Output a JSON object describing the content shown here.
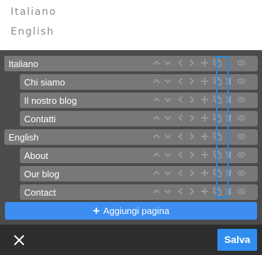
{
  "language_switcher": {
    "items": [
      "Italiano",
      "English"
    ]
  },
  "pages": {
    "italiano": {
      "label": "Italiano",
      "children": [
        "Chi siamo",
        "Il nostro blog",
        "Contatti"
      ]
    },
    "english": {
      "label": "English",
      "children": [
        "About",
        "Our blog",
        "Contact"
      ]
    }
  },
  "row_icons": [
    "chevron-up-icon",
    "chevron-down-icon",
    "chevron-left-icon",
    "chevron-right-icon",
    "plus-icon",
    "copy-icon",
    "trash-icon",
    "eye-icon"
  ],
  "add_page_label": "Aggiungi pagina",
  "footer": {
    "save_label": "Salva"
  },
  "colors": {
    "panel_bg": "#4b4b4b",
    "row_bg": "#787878",
    "accent": "#3d8ef0",
    "highlight": "#1e8ae6",
    "footer_bg": "#2e2e2e"
  }
}
